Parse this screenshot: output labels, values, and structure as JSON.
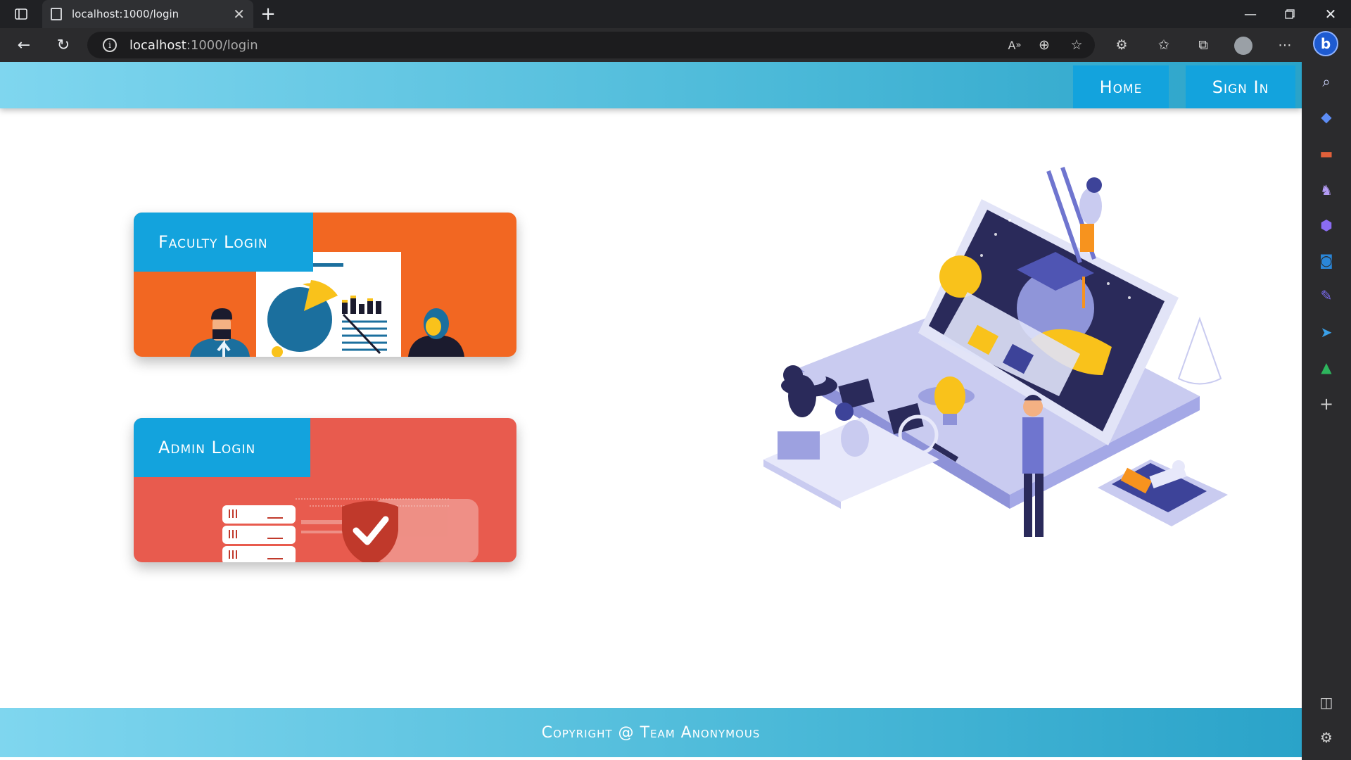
{
  "browser": {
    "tab_title": "localhost:1000/login",
    "url_host": "localhost",
    "url_path": ":1000/login"
  },
  "navbar": {
    "home_label": "Home",
    "signin_label": "Sign In"
  },
  "cards": {
    "faculty_label": "Faculty Login",
    "admin_label": "Admin Login"
  },
  "footer": {
    "text": "Copyright @ Team Anonymous"
  },
  "colors": {
    "accent": "#13a3dd",
    "faculty_bg": "#f26722",
    "admin_bg": "#e85b4e"
  }
}
